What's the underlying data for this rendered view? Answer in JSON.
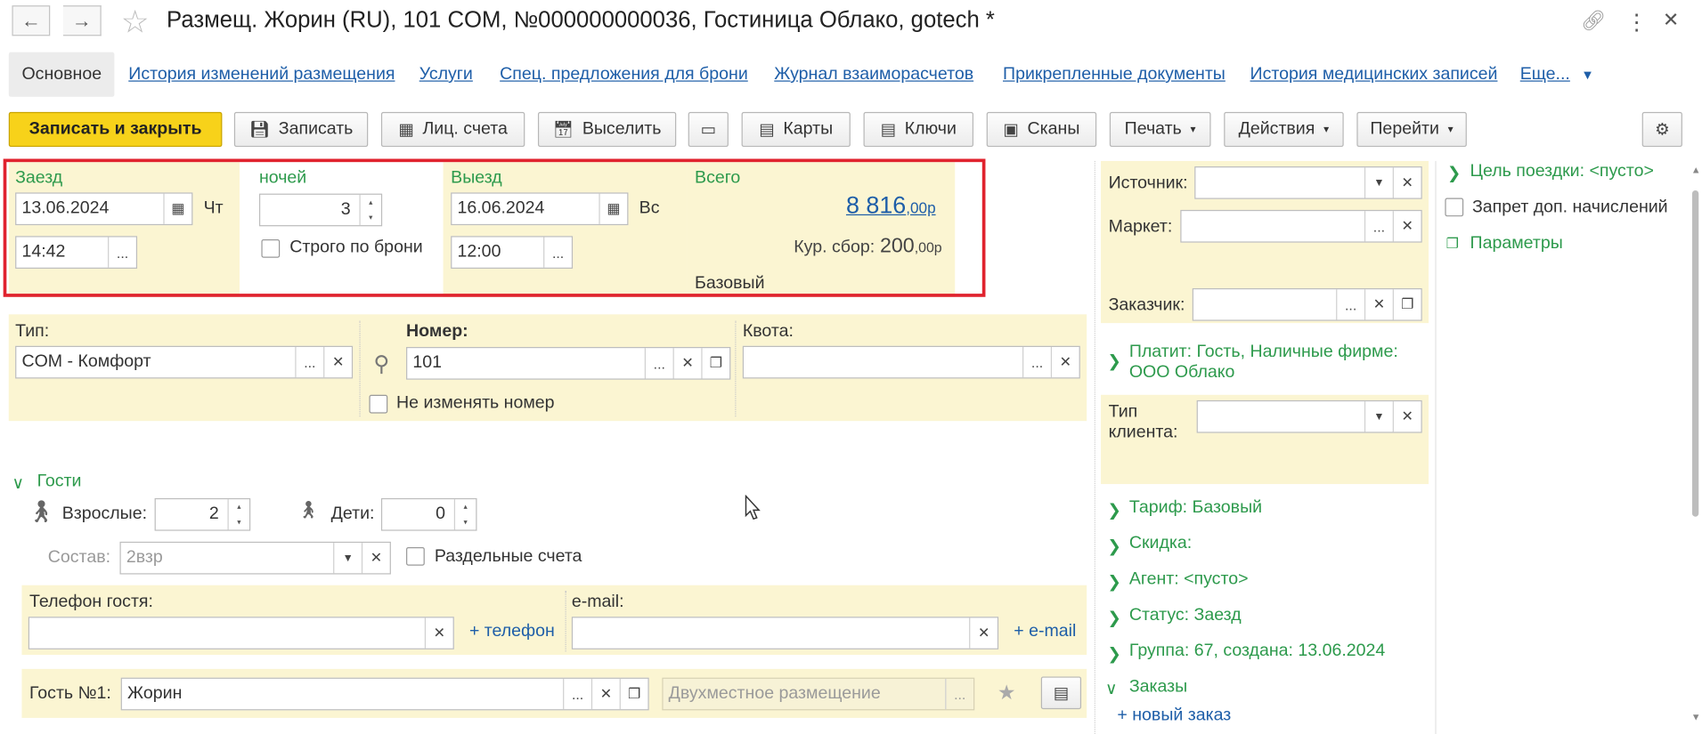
{
  "window": {
    "title": "Размещ. Жорин (RU), 101 COM, №000000000036, Гостиница Облако, gotech *"
  },
  "tabs": [
    {
      "label": "Основное",
      "active": true
    },
    {
      "label": "История изменений размещения"
    },
    {
      "label": "Услуги"
    },
    {
      "label": "Спец. предложения для брони"
    },
    {
      "label": "Журнал взаиморасчетов"
    },
    {
      "label": "Прикрепленные документы"
    },
    {
      "label": "История медицинских записей"
    },
    {
      "label": "Еще..."
    }
  ],
  "toolbar": {
    "save_close": "Записать и закрыть",
    "save": "Записать",
    "accounts": "Лиц. счета",
    "checkout": "Выселить",
    "cards": "Карты",
    "keys": "Ключи",
    "scans": "Сканы",
    "print": "Печать",
    "actions": "Действия",
    "goto": "Перейти"
  },
  "stay": {
    "checkin_label": "Заезд",
    "checkin_date": "13.06.2024",
    "checkin_dow": "Чт",
    "checkin_time": "14:42",
    "nights_label": "ночей",
    "nights": "3",
    "strict_label": "Строго по брони",
    "checkout_label": "Выезд",
    "checkout_date": "16.06.2024",
    "checkout_dow": "Вс",
    "checkout_time": "12:00",
    "total_label": "Всего",
    "total_main": "8 816",
    "total_cents": ",00р",
    "tax_label": "Кур. сбор:",
    "tax_main": "200",
    "tax_cents": ",00р",
    "rate_name": "Базовый"
  },
  "room": {
    "type_label": "Тип:",
    "type_value": "COM - Комфорт",
    "number_label": "Номер:",
    "number_value": "101",
    "quota_label": "Квота:",
    "quota_value": "",
    "keep_room_label": "Не изменять номер"
  },
  "guests": {
    "header": "Гости",
    "adults_label": "Взрослые:",
    "adults": "2",
    "children_label": "Дети:",
    "children": "0",
    "composition_label": "Состав:",
    "composition": "2взр",
    "separate_label": "Раздельные счета",
    "phone_label": "Телефон гостя:",
    "phone_add": "+ телефон",
    "email_label": "e-mail:",
    "email_add": "+ e-mail",
    "guest1_label": "Гость №1:",
    "guest1_value": "Жорин",
    "guest1_accommodation_placeholder": "Двухместное размещение"
  },
  "right_panel": {
    "source_label": "Источник:",
    "market_label": "Маркет:",
    "customer_label": "Заказчик:",
    "payer": "Платит: Гость, Наличные фирме: ООО Облако",
    "client_type_label": "Тип клиента:",
    "tariff": "Тариф: Базовый",
    "discount": "Скидка:",
    "agent": "Агент: <пусто>",
    "status": "Статус: Заезд",
    "group": "Группа: 67, создана: 13.06.2024",
    "orders": "Заказы",
    "new_order": "+ новый заказ"
  },
  "far_right": {
    "trip_goal": "Цель поездки: <пусто>",
    "no_extra_charges": "Запрет доп. начислений",
    "params": "Параметры"
  },
  "colors": {
    "yellow_bg": "#fbf5d2",
    "green": "#2d9a4c",
    "link_blue": "#1e5ea8",
    "highlight_red": "#e0232e",
    "primary_button": "#f7d21a"
  }
}
